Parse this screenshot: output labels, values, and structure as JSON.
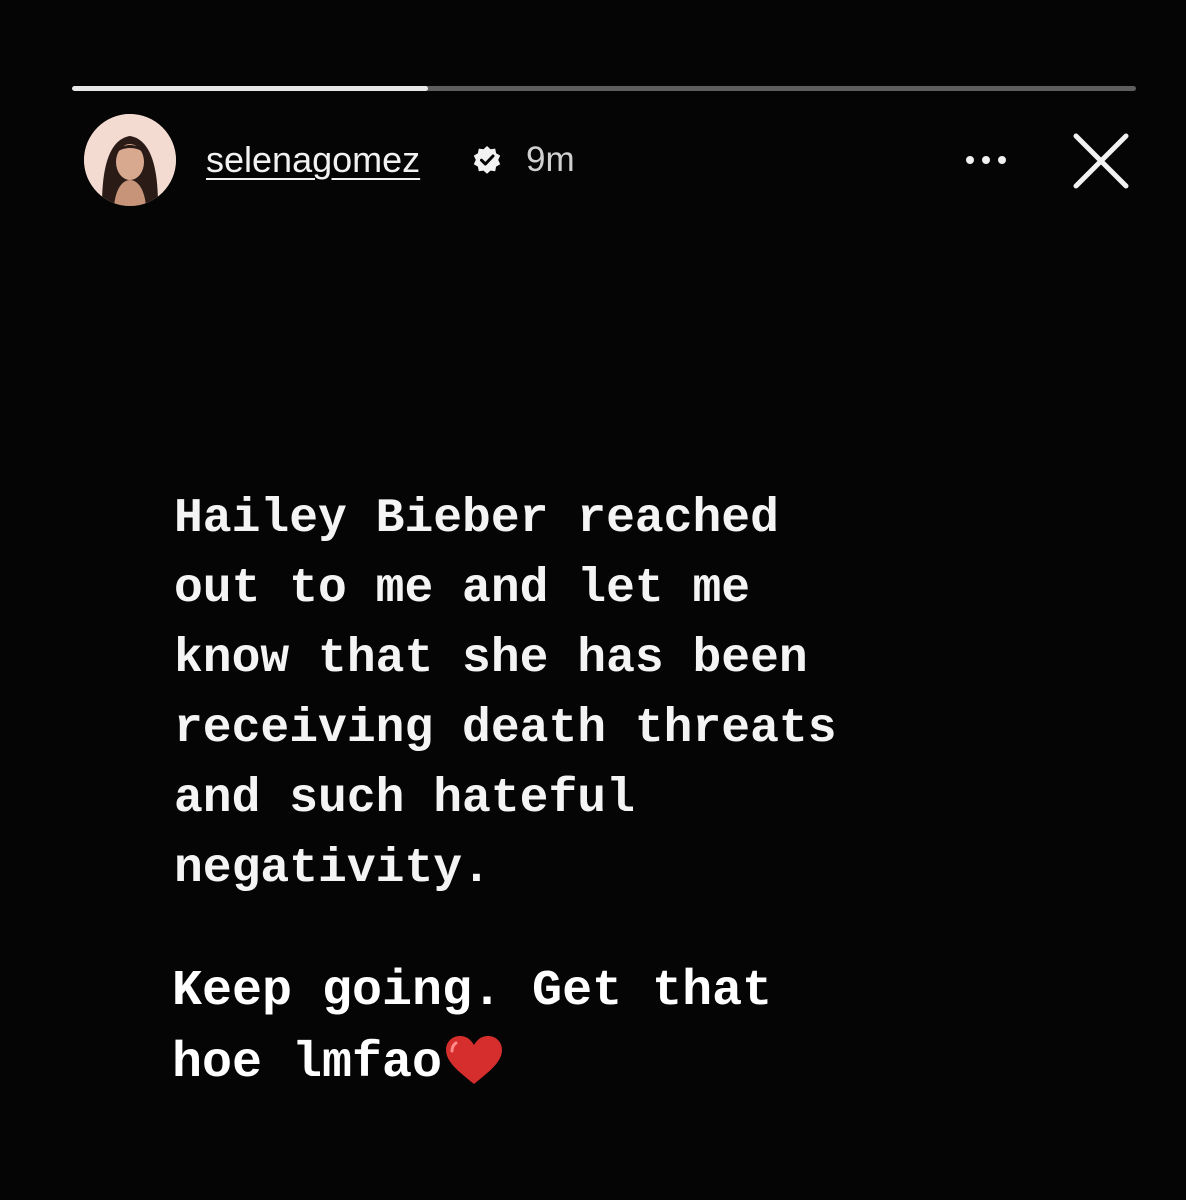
{
  "story": {
    "progress": 0.335
  },
  "header": {
    "username": "selenagomez",
    "verified_icon": "verified-badge-icon",
    "time_ago": "9m",
    "more_icon": "more-horizontal-icon",
    "close_icon": "close-icon"
  },
  "content": {
    "lines": [
      "Hailey Bieber reached",
      "out to me and let me",
      "know that she has been",
      "receiving death threats",
      "and such hateful",
      "negativity."
    ]
  },
  "caption": {
    "lines": [
      "Keep going. Get that",
      "hoe lmfao"
    ],
    "emoji_icon": "red-heart-icon"
  },
  "colors": {
    "background": "#050505",
    "progress_track": "#5e5e5e",
    "progress_fill": "#e8e8e8",
    "heart": "#d62d2d"
  }
}
